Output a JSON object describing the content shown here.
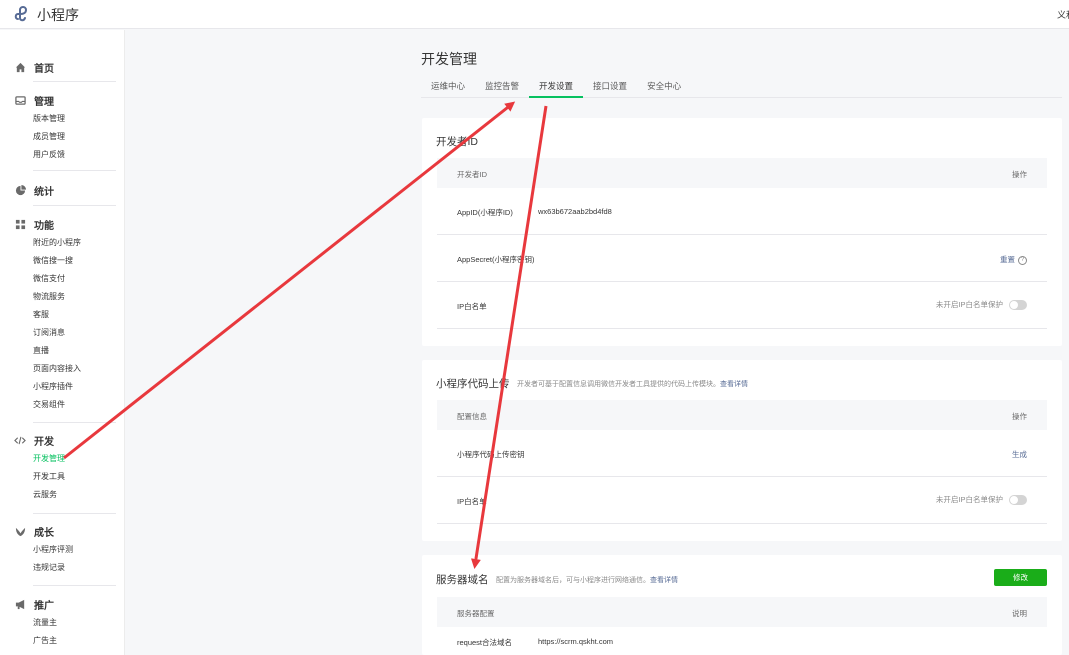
{
  "app": {
    "title": "小程序",
    "user": "义和"
  },
  "sidebar": {
    "groups": [
      {
        "label": "首页",
        "icon": "home-icon",
        "items": []
      },
      {
        "label": "管理",
        "icon": "inbox-icon",
        "items": [
          "版本管理",
          "成员管理",
          "用户反馈"
        ]
      },
      {
        "label": "统计",
        "icon": "pie-chart-icon",
        "items": []
      },
      {
        "label": "功能",
        "icon": "grid-icon",
        "items": [
          "附近的小程序",
          "微信搜一搜",
          "微信支付",
          "物流服务",
          "客服",
          "订阅消息",
          "直播",
          "页面内容接入",
          "小程序插件",
          "交易组件"
        ]
      },
      {
        "label": "开发",
        "icon": "code-icon",
        "items": [
          "开发管理",
          "开发工具",
          "云服务"
        ]
      },
      {
        "label": "成长",
        "icon": "leaf-icon",
        "items": [
          "小程序评测",
          "违规记录"
        ]
      },
      {
        "label": "推广",
        "icon": "megaphone-icon",
        "items": [
          "流量主",
          "广告主"
        ]
      }
    ],
    "active_item": "开发管理"
  },
  "main": {
    "page_title": "开发管理",
    "tabs": [
      "运维中心",
      "监控告警",
      "开发设置",
      "接口设置",
      "安全中心"
    ],
    "active_tab": "开发设置",
    "dev_settings": {
      "title": "开发者ID",
      "header_left": "开发者ID",
      "header_right": "操作",
      "appid_label": "AppID(小程序ID)",
      "appid_value": "wx63b672aab2bd4fd8",
      "appsecret_label": "AppSecret(小程序密钥)",
      "appsecret_action": "重置",
      "ip_label": "IP白名单",
      "ip_status": "未开启IP白名单保护"
    },
    "code_upload": {
      "title": "小程序代码上传",
      "desc": "开发者可基于配置信息调用微信开发者工具提供的代码上传模块。",
      "desc_link": "查看详情",
      "header_left": "配置信息",
      "header_right": "操作",
      "key_label": "小程序代码上传密钥",
      "key_action": "生成",
      "ip_label": "IP白名单",
      "ip_status": "未开启IP白名单保护"
    },
    "server_domain": {
      "title": "服务器域名",
      "desc": "配置为服务器域名后，可与小程序进行网络通信。",
      "desc_link": "查看详情",
      "button": "修改",
      "header_left": "服务器配置",
      "header_right": "说明",
      "request_label": "request合法域名",
      "request_value": "https://scrm.qskht.com"
    }
  },
  "annotation_colors": {
    "arrow": "#e8383d",
    "accent": "#07c160"
  }
}
